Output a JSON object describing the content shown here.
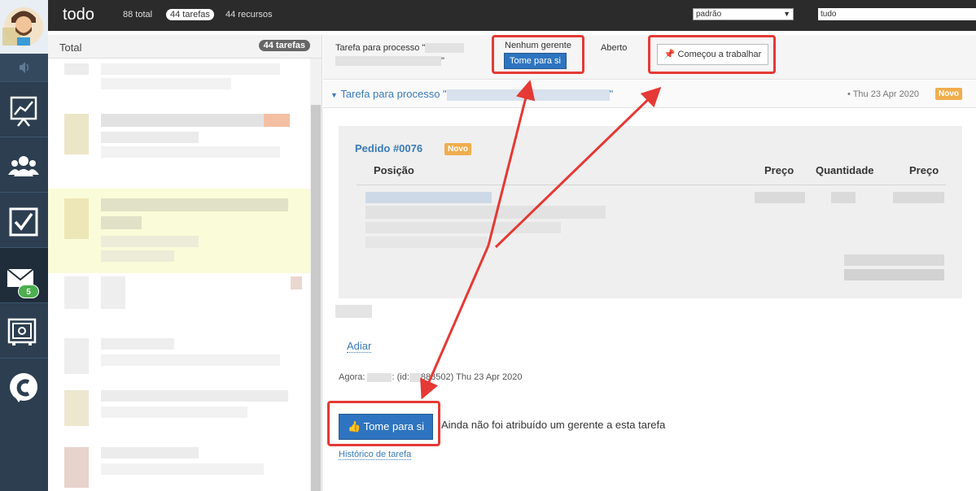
{
  "app": {
    "title": "todo",
    "stats": {
      "total": "88 total",
      "tasks": "44 tarefas",
      "resources": "44 recursos"
    },
    "filter_select": "padrão",
    "search_value": "tudo"
  },
  "rail": {
    "icons": [
      "avatar",
      "volume-icon",
      "chart-icon",
      "users-icon",
      "checkbox-icon",
      "mail-icon",
      "safe-icon",
      "logo-c-icon"
    ],
    "mail_badge": "5"
  },
  "list": {
    "title": "Total",
    "count": "44 tarefas"
  },
  "task": {
    "header_title_prefix": "Tarefa para processo \"",
    "header_title_suffix": "\"",
    "no_manager": "Nenhum gerente",
    "take_button": "Tome para si",
    "status": "Aberto",
    "start_button": "Começou a trabalhar",
    "line_title_prefix": "Tarefa para processo \"",
    "line_title_suffix": "\"",
    "date": "• Thu 23 Apr 2020",
    "tag": "Novo"
  },
  "order": {
    "id": "Pedido #0076",
    "tag": "Novo",
    "columns": [
      "Posição",
      "Preço",
      "Quantidade",
      "Preço"
    ]
  },
  "footer": {
    "postpone_link": "Adiar",
    "now_prefix": "Agora:",
    "now_text": ": (id:",
    "now_suffix": "888502) Thu 23 Apr 2020",
    "take_button": "Tome para si",
    "not_assigned": "Ainda não foi atribuído um gerente a esta tarefa",
    "history_link": "Histórico de tarefa"
  },
  "colors": {
    "accent": "#2e74c0",
    "link": "#3a7ab8",
    "highlight": "#e53935",
    "tag": "#f0ad4e",
    "rail": "#2c3e50"
  }
}
